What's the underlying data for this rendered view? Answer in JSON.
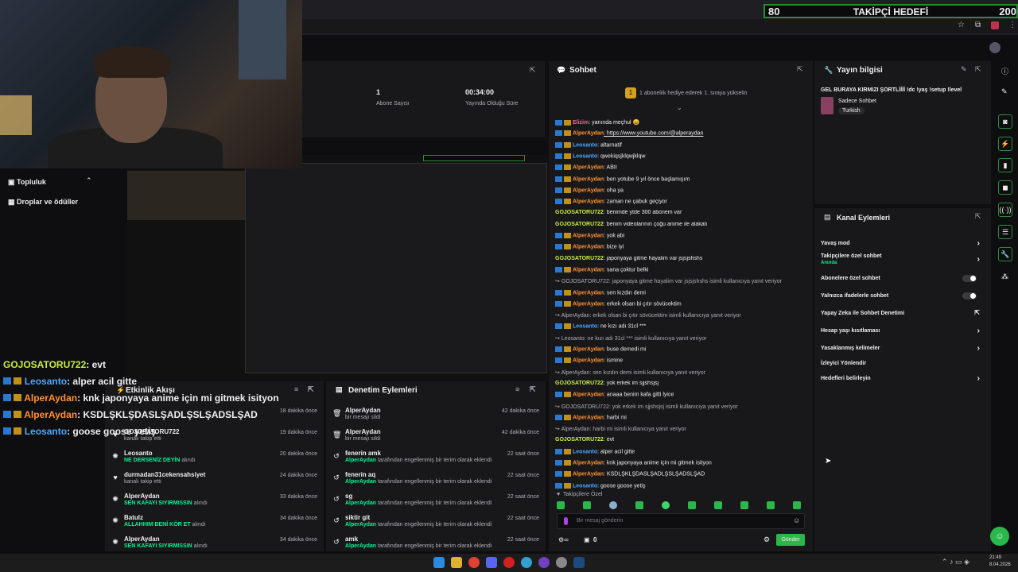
{
  "goal": {
    "current": "80",
    "title": "TAKİPÇİ HEDEFİ",
    "target": "200"
  },
  "nav": {
    "community": "Topluluk",
    "drops": "Droplar ve ödüller"
  },
  "stats": [
    {
      "value": "1",
      "label": "Abone Sayısı"
    },
    {
      "value": "00:34:00",
      "label": "Yayında Olduğu Süre"
    }
  ],
  "overlay_chat": [
    {
      "user": "GOJOSATORU722",
      "msg": ": evt",
      "color": "#c8f040"
    },
    {
      "user": "Leosanto",
      "msg": ": alper acil gitte",
      "color": "#4aa8ff"
    },
    {
      "user": "AlperAydan",
      "msg": ": knk japonyaya anime için mi gitmek isityon",
      "color": "#ff9030"
    },
    {
      "user": "AlperAydan",
      "msg": ": KSDLŞKLŞDASLŞADLŞSLŞADSLŞAD",
      "color": "#ff9030"
    },
    {
      "user": "Leosanto",
      "msg": ": goose goose yetiş",
      "color": "#4aa8ff"
    }
  ],
  "activity": {
    "title": "Etkinlik Akışı",
    "items": [
      {
        "name": "",
        "sub": "",
        "time": "18 dakika önce"
      },
      {
        "name": "GOJOSATORU722",
        "sub": "kanalı takip etti",
        "time": "19 dakika önce"
      },
      {
        "name": "Leosanto",
        "sub_hl": "NE DERSENİZ DEYİN",
        "sub": " alındı",
        "time": "20 dakika önce"
      },
      {
        "name": "durmadan31cekensahsiyet",
        "sub": "kanalı takip etti",
        "time": "24 dakika önce"
      },
      {
        "name": "AlperAydan",
        "sub_hl": "SEN KAFAYI SIYIRMISSIN",
        "sub": " alındı",
        "time": "33 dakika önce"
      },
      {
        "name": "Batulz",
        "sub_hl": "ALLAHHIM BENİ KÖR ET",
        "sub": " alındı",
        "time": "34 dakika önce"
      },
      {
        "name": "AlperAydan",
        "sub_hl": "SEN KAFAYI SIYIRMISSIN",
        "sub": " alındı",
        "time": "34 dakika önce"
      }
    ]
  },
  "moderation": {
    "title": "Denetim Eylemleri",
    "items": [
      {
        "name": "AlperAydan",
        "sub": "bir mesajı sildi",
        "time": "42 dakika önce"
      },
      {
        "name": "AlperAydan",
        "sub": "bir mesajı sildi",
        "time": "42 dakika önce"
      },
      {
        "name": "fenerin amk",
        "sub_hl": "AlperAydan",
        "sub": " tarafından engellenmiş bir terim olarak eklendi",
        "time": "22 saat önce"
      },
      {
        "name": "fenerin aq",
        "sub_hl": "AlperAydan",
        "sub": " tarafından engellenmiş bir terim olarak eklendi",
        "time": "22 saat önce"
      },
      {
        "name": "sg",
        "sub_hl": "AlperAydan",
        "sub": " tarafından engellenmiş bir terim olarak eklendi",
        "time": "22 saat önce"
      },
      {
        "name": "siktir git",
        "sub_hl": "AlperAydan",
        "sub": " tarafından engellenmiş bir terim olarak eklendi",
        "time": "22 saat önce"
      },
      {
        "name": "amk",
        "sub_hl": "AlperAydan",
        "sub": " tarafından engellenmiş bir terim olarak eklendi",
        "time": "22 saat önce"
      }
    ]
  },
  "chat": {
    "title": "Sohbet",
    "pinned": "1 aboneliik hediye ederek 1. sıraya yükselin",
    "lines": [
      {
        "user": "Elizim",
        "msg": ": yanında meçhul 😄",
        "color": "#ff6090",
        "badges": 2
      },
      {
        "user": "AlperAydan",
        "msg": ": https://www.youtube.com/@alperaydan",
        "color": "#ff9030",
        "badges": 2
      },
      {
        "user": "Leosanto",
        "msg": ": altarnatif",
        "color": "#4aa8ff",
        "badges": 2
      },
      {
        "user": "Leosanto",
        "msg": ": qwekiqsjklqwjklqw",
        "color": "#4aa8ff",
        "badges": 2
      },
      {
        "user": "AlperAydan",
        "msg": ": ABİİ",
        "color": "#ff9030",
        "badges": 2
      },
      {
        "user": "AlperAydan",
        "msg": ": ben yotube 9 yıl önce başlamışım",
        "color": "#ff9030",
        "badges": 2
      },
      {
        "user": "AlperAydan",
        "msg": ": oha ya",
        "color": "#ff9030",
        "badges": 2
      },
      {
        "user": "AlperAydan",
        "msg": ": zaman ne çabuk geçiyor",
        "color": "#ff9030",
        "badges": 2
      },
      {
        "user": "GOJOSATORU722",
        "msg": ": benimde ytde 300 abonem var",
        "color": "#c8f040",
        "badges": 0
      },
      {
        "user": "GOJOSATORU722",
        "msg": ": benim videolarının çoğu anime ile alakalı",
        "color": "#c8f040",
        "badges": 0
      },
      {
        "user": "AlperAydan",
        "msg": ": yok abi",
        "color": "#ff9030",
        "badges": 2
      },
      {
        "user": "AlperAydan",
        "msg": ": bize iyi",
        "color": "#ff9030",
        "badges": 2
      },
      {
        "user": "GOJOSATORU722",
        "msg": ": japonyaya gitme hayalim var jsjsjshshs",
        "color": "#c8f040",
        "badges": 0
      },
      {
        "user": "AlperAydan",
        "msg": ": sana çoktur belki",
        "color": "#ff9030",
        "badges": 2
      },
      {
        "reply": "GOJOSATORU722: japonyaya gitme hayalim var jsjsjshshs isimli kullanıcıya yanıt veriyor"
      },
      {
        "user": "AlperAydan",
        "msg": ": sen kızdın demi",
        "color": "#ff9030",
        "badges": 2
      },
      {
        "user": "AlperAydan",
        "msg": ": erkek olsan bi çıtır sövücektim",
        "color": "#ff9030",
        "badges": 2
      },
      {
        "reply": "AlperAydan: erkek olsan bi çıtır sövücektim isimli kullanıcıya yanıt veriyor"
      },
      {
        "user": "Leosanto",
        "msg": ": ne kızı adı 31cl ***",
        "color": "#4aa8ff",
        "badges": 2
      },
      {
        "reply": "Leosanto: ne kızı adı 31cl *** isimli kullanıcıya yanıt veriyor"
      },
      {
        "user": "AlperAydan",
        "msg": ": buse demedi mi",
        "color": "#ff9030",
        "badges": 2
      },
      {
        "user": "AlperAydan",
        "msg": ": ismine",
        "color": "#ff9030",
        "badges": 2
      },
      {
        "reply": "AlperAydan: sen kızdın demi isimli kullanıcıya yanıt veriyor"
      },
      {
        "user": "GOJOSATORU722",
        "msg": ": yok erkek im sjjshsjsj",
        "color": "#c8f040",
        "badges": 0
      },
      {
        "user": "AlperAydan",
        "msg": ": anaaa benim kafa gitti lyice",
        "color": "#ff9030",
        "badges": 2
      },
      {
        "reply": "GOJOSATORU722: yok erkek im sjjshsjsj isimli kullanıcıya yanıt veriyor"
      },
      {
        "user": "AlperAydan",
        "msg": ": harbi mi",
        "color": "#ff9030",
        "badges": 2
      },
      {
        "reply": "AlperAydan: harbi mi isimli kullanıcıya yanıt veriyor"
      },
      {
        "user": "GOJOSATORU722",
        "msg": ": evt",
        "color": "#c8f040",
        "badges": 0
      },
      {
        "user": "Leosanto",
        "msg": ": alper acil gitte",
        "color": "#4aa8ff",
        "badges": 2
      },
      {
        "user": "AlperAydan",
        "msg": ": knk japonyaya anime için mi gitmek isityon",
        "color": "#ff9030",
        "badges": 2
      },
      {
        "user": "AlperAydan",
        "msg": ": KSDLŞKLŞDASLŞADLŞSLŞADSLŞAD",
        "color": "#ff9030",
        "badges": 2
      },
      {
        "user": "Leosanto",
        "msg": ": goose goose yetiş",
        "color": "#4aa8ff",
        "badges": 2
      }
    ],
    "followers_only": "Takipçilere Özel",
    "placeholder": "Bir mesaj gönderin",
    "points": "0",
    "send": "Gönder"
  },
  "stream_info": {
    "title": "Yayın bilgisi",
    "stream_title": "GEL BURAYA KIRMIZI ŞORTLİİİİ !dc !yaş !setup !level",
    "category": "Sadece Sohbet",
    "tag": "Turkish"
  },
  "channel_actions": {
    "title": "Kanal Eylemleri",
    "items": [
      {
        "label": "Yavaş mod",
        "kind": "chevron"
      },
      {
        "label": "Takipçilere özel sohbet",
        "sub": "Anında",
        "kind": "chevron"
      },
      {
        "label": "Abonelere özel sohbet",
        "kind": "toggle"
      },
      {
        "label": "Yalnızca ifadelerle sohbet",
        "kind": "toggle"
      },
      {
        "label": "Yapay Zeka ile Sohbet Denetimi",
        "kind": "external"
      },
      {
        "label": "Hesap yaşı kısıtlaması",
        "kind": "chevron"
      },
      {
        "label": "Yasaklanmış kelimeler",
        "kind": "chevron"
      },
      {
        "label": "İzleyici Yönlendir",
        "kind": "none"
      },
      {
        "label": "Hedefleri belirleyin",
        "kind": "chevron"
      }
    ]
  },
  "taskbar": {
    "time": "21:49",
    "date": "8.04.2026"
  }
}
